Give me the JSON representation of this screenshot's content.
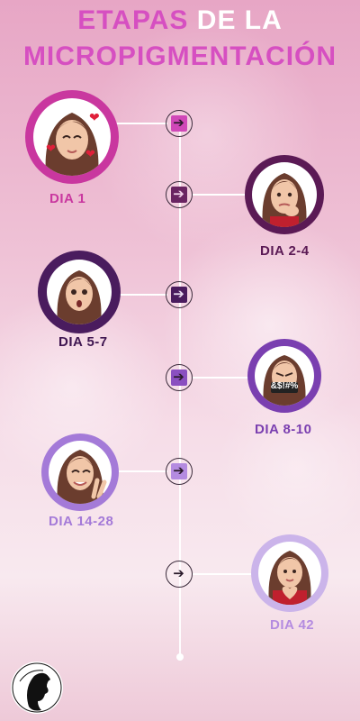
{
  "title": {
    "line1_word1": "ETAPAS",
    "line1_word2": "DE LA",
    "line2": "MICROPIGMENTACIÓN"
  },
  "stages": [
    {
      "label": "DIA 1",
      "color": "#c9379f",
      "side": "left"
    },
    {
      "label": "DIA 2-4",
      "color": "#5b1a55",
      "side": "right"
    },
    {
      "label": "DIA 5-7",
      "color": "#4a1c5e",
      "side": "left"
    },
    {
      "label": "DIA 8-10",
      "color": "#7a3fb0",
      "side": "right"
    },
    {
      "label": "DIA 14-28",
      "color": "#a47ad8",
      "side": "left"
    },
    {
      "label": "DIA 42",
      "color": "#b89ae0",
      "side": "right"
    }
  ],
  "avatars": [
    "heart-eyes-kiss-avatar",
    "nervous-avatar",
    "shocked-avatar",
    "angry-censored-avatar",
    "peace-sign-avatar",
    "heart-hands-avatar"
  ],
  "avatar4_censor": "&$!#%",
  "icons": {
    "node": "arrow-right-icon",
    "logo": "woman-silhouette-logo"
  }
}
